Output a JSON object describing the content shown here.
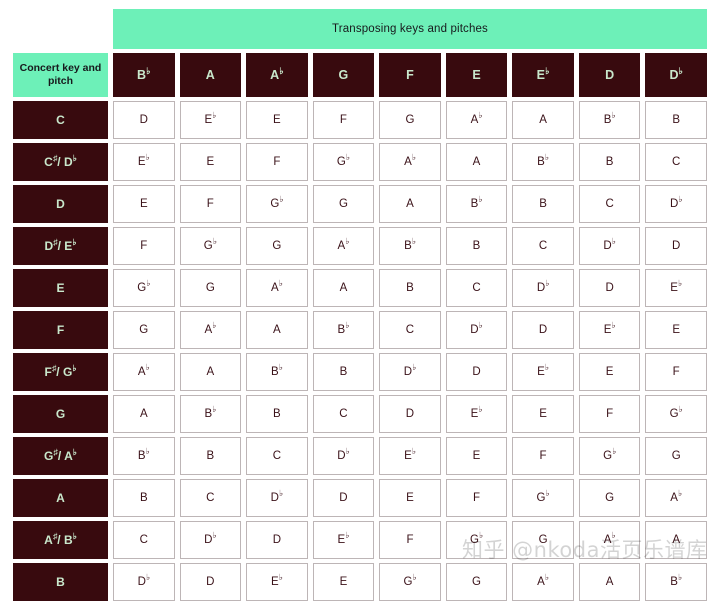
{
  "title": {
    "banner": "Transposing keys and pitches",
    "corner_label": "Concert key and pitch"
  },
  "colors": {
    "banner_bg": "#6df0b8",
    "header_bg": "#380a0e",
    "header_text": "#c9e8cc",
    "cell_bg": "#ffffff",
    "cell_text": "#3a1118",
    "cell_border": "#bdb5b6",
    "page_bg": "#ffffff"
  },
  "watermark": "知乎 @nkoda活页乐谱库",
  "chart_data": {
    "type": "table",
    "title": "Transposing keys and pitches",
    "row_header_label": "Concert key and pitch",
    "categories": [
      "B♭",
      "A",
      "A♭",
      "G",
      "F",
      "E",
      "E♭",
      "D",
      "D♭"
    ],
    "row_labels": [
      "C",
      "C♯/ D♭",
      "D",
      "D♯/ E♭",
      "E",
      "F",
      "F♯/ G♭",
      "G",
      "G♯/ A♭",
      "A",
      "A♯/ B♭",
      "B"
    ],
    "rows": [
      [
        "D",
        "E♭",
        "E",
        "F",
        "G",
        "A♭",
        "A",
        "B♭",
        "B"
      ],
      [
        "E♭",
        "E",
        "F",
        "G♭",
        "A♭",
        "A",
        "B♭",
        "B",
        "C"
      ],
      [
        "E",
        "F",
        "G♭",
        "G",
        "A",
        "B♭",
        "B",
        "C",
        "D♭"
      ],
      [
        "F",
        "G♭",
        "G",
        "A♭",
        "B♭",
        "B",
        "C",
        "D♭",
        "D"
      ],
      [
        "G♭",
        "G",
        "A♭",
        "A",
        "B",
        "C",
        "D♭",
        "D",
        "E♭"
      ],
      [
        "G",
        "A♭",
        "A",
        "B♭",
        "C",
        "D♭",
        "D",
        "E♭",
        "E"
      ],
      [
        "A♭",
        "A",
        "B♭",
        "B",
        "D♭",
        "D",
        "E♭",
        "E",
        "F"
      ],
      [
        "A",
        "B♭",
        "B",
        "C",
        "D",
        "E♭",
        "E",
        "F",
        "G♭"
      ],
      [
        "B♭",
        "B",
        "C",
        "D♭",
        "E♭",
        "E",
        "F",
        "G♭",
        "G"
      ],
      [
        "B",
        "C",
        "D♭",
        "D",
        "E",
        "F",
        "G♭",
        "G",
        "A♭"
      ],
      [
        "C",
        "D♭",
        "D",
        "E♭",
        "F",
        "G♭",
        "G",
        "A♭",
        "A"
      ],
      [
        "D♭",
        "D",
        "E♭",
        "E",
        "G♭",
        "G",
        "A♭",
        "A",
        "B♭"
      ]
    ]
  }
}
